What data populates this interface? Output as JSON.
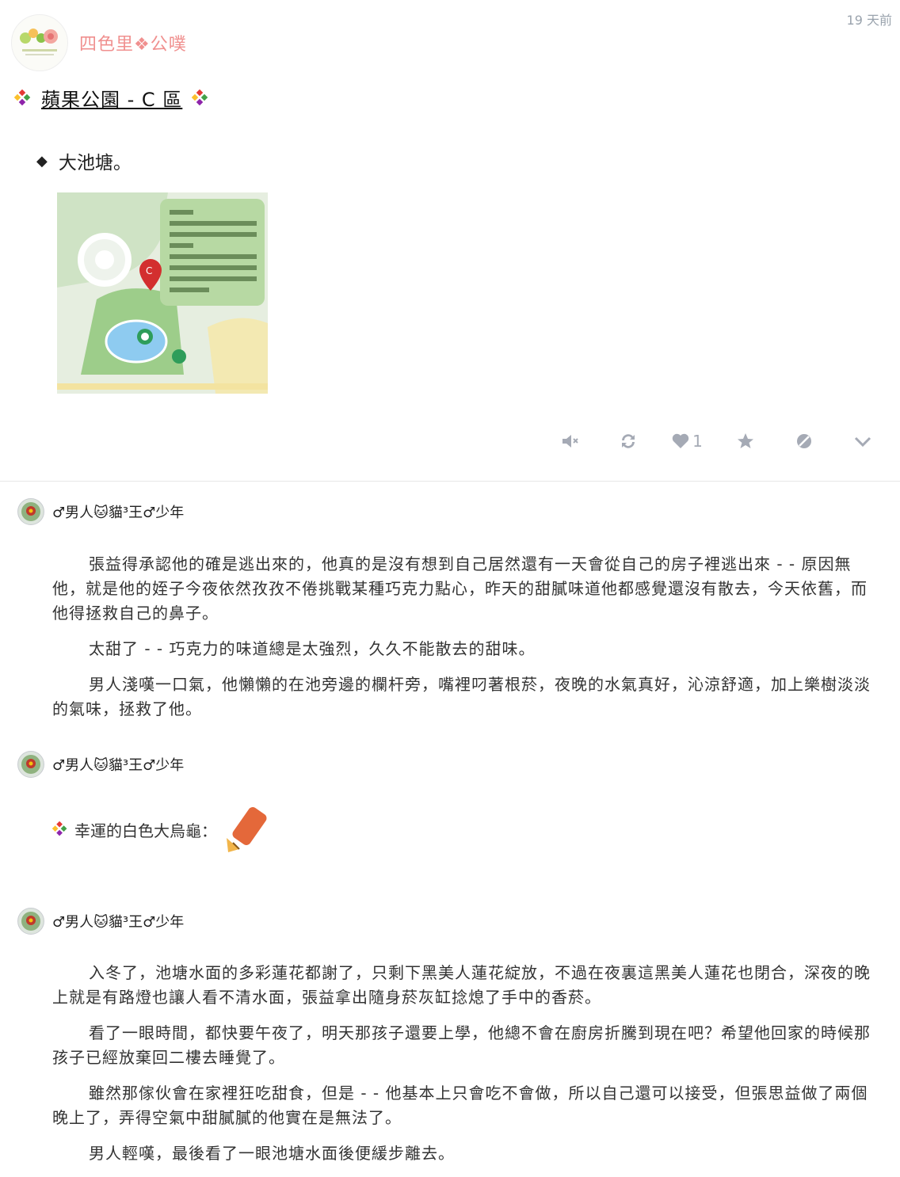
{
  "header": {
    "blog_name": "四色里❖公噗",
    "timestamp": "19 天前"
  },
  "post": {
    "title": "蘋果公園 - C 區",
    "section_bullet": "◆",
    "section_title": "大池塘。",
    "actions": {
      "like_count": "1"
    }
  },
  "reblogs": [
    {
      "user": "♂男人🐱貓³王♂少年",
      "paragraphs": [
        "張益得承認他的確是逃出來的，他真的是沒有想到自己居然還有一天會從自己的房子裡逃出來 - - 原因無他，就是他的姪子今夜依然孜孜不倦挑戰某種巧克力點心，昨天的甜膩味道他都感覺還沒有散去，今天依舊，而他得拯救自己的鼻子。",
        "太甜了 - - 巧克力的味道總是太強烈，久久不能散去的甜味。",
        "男人淺嘆一口氣，他懶懶的在池旁邊的欄杆旁，嘴裡叼著根菸，夜晚的水氣真好，沁涼舒適，加上樂樹淡淡的氣味，拯救了他。"
      ]
    },
    {
      "user": "♂男人🐱貓³王♂少年",
      "turtle_label": "幸運的白色大烏龜："
    },
    {
      "user": "♂男人🐱貓³王♂少年",
      "paragraphs": [
        "入冬了，池塘水面的多彩蓮花都謝了，只剩下黑美人蓮花綻放，不過在夜裏這黑美人蓮花也閉合，深夜的晚上就是有路燈也讓人看不清水面，張益拿出隨身菸灰缸捻熄了手中的香菸。",
        "看了一眼時間，都快要午夜了，明天那孩子還要上學，他總不會在廚房折騰到現在吧？希望他回家的時候那孩子已經放棄回二樓去睡覺了。",
        "雖然那傢伙會在家裡狂吃甜食，但是 - - 他基本上只會吃不會做，所以自己還可以接受，但張思益做了兩個晚上了，弄得空氣中甜膩膩的他實在是無法了。",
        "男人輕嘆，最後看了一眼池塘水面後便緩步離去。"
      ]
    }
  ]
}
